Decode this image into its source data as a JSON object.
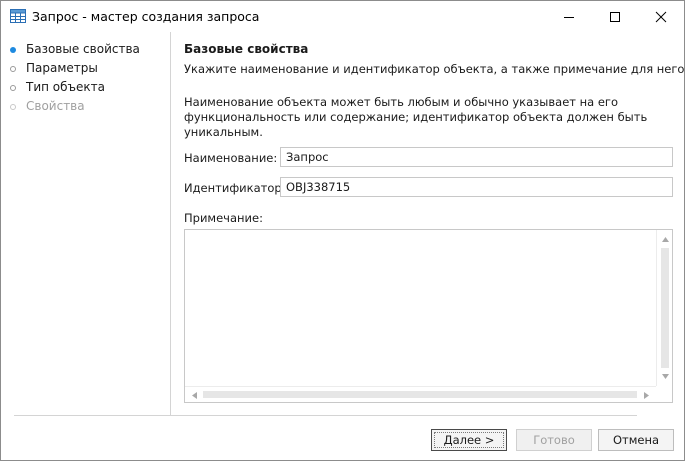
{
  "window": {
    "title": "Запрос - мастер создания запроса",
    "icon": "table-grid-icon"
  },
  "nav": {
    "items": [
      {
        "label": "Базовые свойства",
        "state": "active"
      },
      {
        "label": "Параметры",
        "state": "inactive"
      },
      {
        "label": "Тип объекта",
        "state": "inactive"
      },
      {
        "label": "Свойства",
        "state": "disabled"
      }
    ]
  },
  "main": {
    "heading": "Базовые свойства",
    "subheading": "Укажите наименование и идентификатор объекта, а также примечание для него.",
    "info": "Наименование объекта может быть любым и обычно указывает на его функциональность или содержание; идентификатор объекта должен быть уникальным.",
    "name_label": "Наименование:",
    "name_value": "Запрос",
    "id_label": "Идентификатор:",
    "id_value": "OBJ338715",
    "note_label": "Примечание:",
    "note_value": ""
  },
  "footer": {
    "next_label": "Далее >",
    "done_label": "Готово",
    "cancel_label": "Отмена"
  },
  "colors": {
    "accent": "#1e8ae0",
    "disabled_text": "#a0a0a0",
    "border": "#c8c8c8"
  }
}
